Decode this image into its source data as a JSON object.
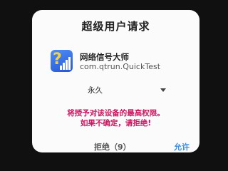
{
  "dialog": {
    "title": "超级用户请求",
    "app": {
      "icon": "signal-strength-question-icon",
      "name": "网络信号大师",
      "package": "com.qtrun.QuickTest"
    },
    "duration_select": {
      "value": "永久"
    },
    "warning": {
      "line1": "将授予对该设备的最高权限。",
      "line2": "如果不确定，请拒绝!"
    },
    "buttons": {
      "deny": "拒绝（9）",
      "allow": "允许"
    }
  },
  "colors": {
    "warning": "#cc1560",
    "accent": "#3a8ee6",
    "dialog_bg": "#fbfbfb",
    "backdrop": "#101010"
  }
}
